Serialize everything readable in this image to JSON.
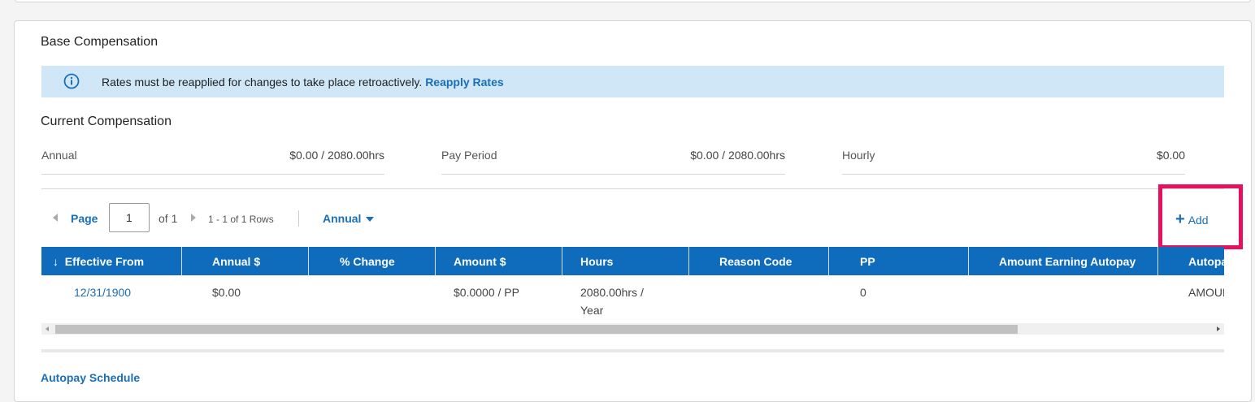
{
  "section": {
    "title": "Base Compensation"
  },
  "banner": {
    "icon": "info-icon",
    "text": "Rates must be reapplied for changes to take place retroactively.",
    "link_label": "Reapply Rates"
  },
  "current": {
    "title": "Current Compensation",
    "fields": [
      {
        "label": "Annual",
        "value": "$0.00 / 2080.00hrs"
      },
      {
        "label": "Pay Period",
        "value": "$0.00 / 2080.00hrs"
      },
      {
        "label": "Hourly",
        "value": "$0.00"
      }
    ]
  },
  "pager": {
    "page_label": "Page",
    "page_value": "1",
    "of_label": "of 1",
    "rows_label": "1 - 1 of 1 Rows",
    "view_label": "Annual"
  },
  "add_button": {
    "label": "Add"
  },
  "table": {
    "sort_indicator": "↓",
    "columns": [
      "Effective From",
      "Annual $",
      "% Change",
      "Amount $",
      "Hours",
      "Reason Code",
      "PP",
      "Amount Earning Autopay",
      "Autopay"
    ],
    "rows": [
      {
        "effective_from": "12/31/1900",
        "annual": "$0.00",
        "change": "",
        "amount": "$0.0000 / PP",
        "hours_1": "2080.00hrs /",
        "hours_2": "Year",
        "reason": "",
        "pp": "0",
        "amount_autopay": "",
        "autopay": "AMOUNT"
      }
    ]
  },
  "footer": {
    "autopay_link": "Autopay Schedule"
  },
  "colors": {
    "accent": "#0f6cbd",
    "link": "#1a6fb6",
    "highlight": "#e8105e",
    "banner_bg": "#cfe7f7"
  }
}
